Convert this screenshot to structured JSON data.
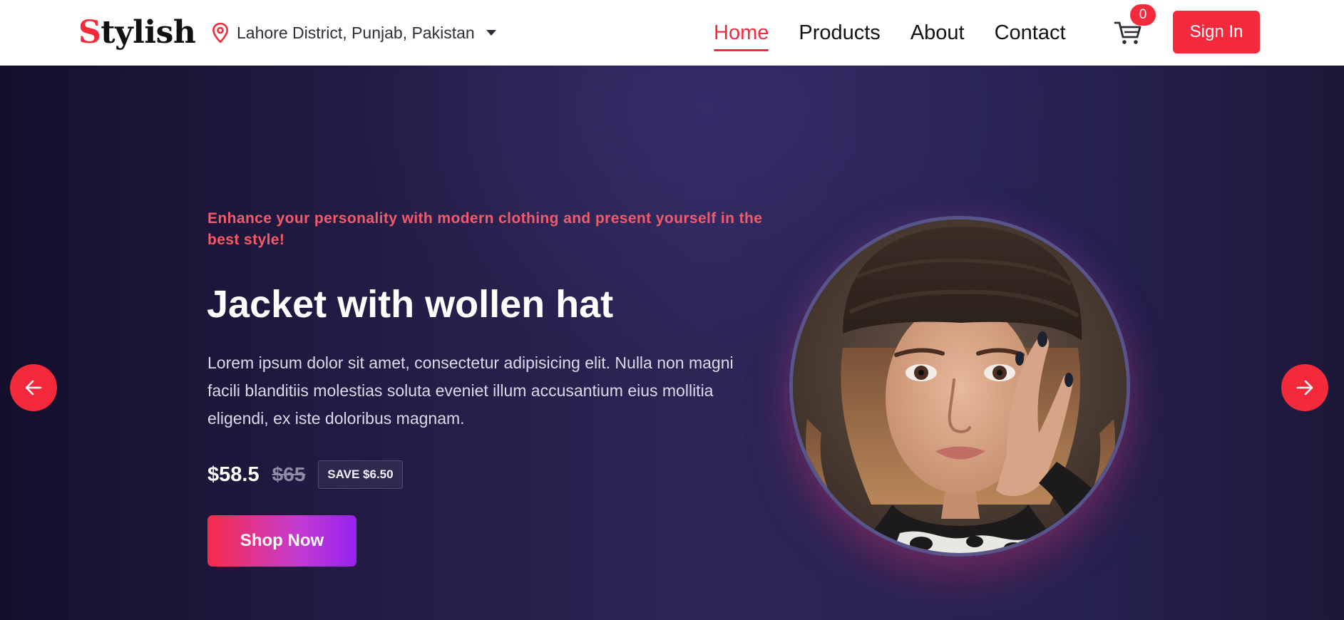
{
  "header": {
    "logo_first": "S",
    "logo_rest": "tylish",
    "location": "Lahore District, Punjab, Pakistan",
    "nav": [
      {
        "label": "Home",
        "active": true
      },
      {
        "label": "Products",
        "active": false
      },
      {
        "label": "About",
        "active": false
      },
      {
        "label": "Contact",
        "active": false
      }
    ],
    "cart_count": "0",
    "signin_label": "Sign In"
  },
  "hero": {
    "tagline": "Enhance your personality with modern clothing and present yourself in the best style!",
    "title": "Jacket with wollen hat",
    "description": "Lorem ipsum dolor sit amet, consectetur adipisicing elit. Nulla non magni facili blanditiis molestias soluta eveniet illum accusantium eius mollitia eligendi, ex iste doloribus magnam.",
    "price": "$58.5",
    "old_price": "$65",
    "save_badge": "SAVE $6.50",
    "cta_label": "Shop Now",
    "image_icon": "woman-portrait-image"
  },
  "colors": {
    "accent": "#f22a3c",
    "hero_bg": "#2a2454",
    "cta_gradient_start": "#f72c48",
    "cta_gradient_end": "#9522f0"
  },
  "icons": {
    "location": "location-pin-icon",
    "caret": "caret-down-icon",
    "cart": "cart-icon",
    "prev": "arrow-left-icon",
    "next": "arrow-right-icon"
  }
}
